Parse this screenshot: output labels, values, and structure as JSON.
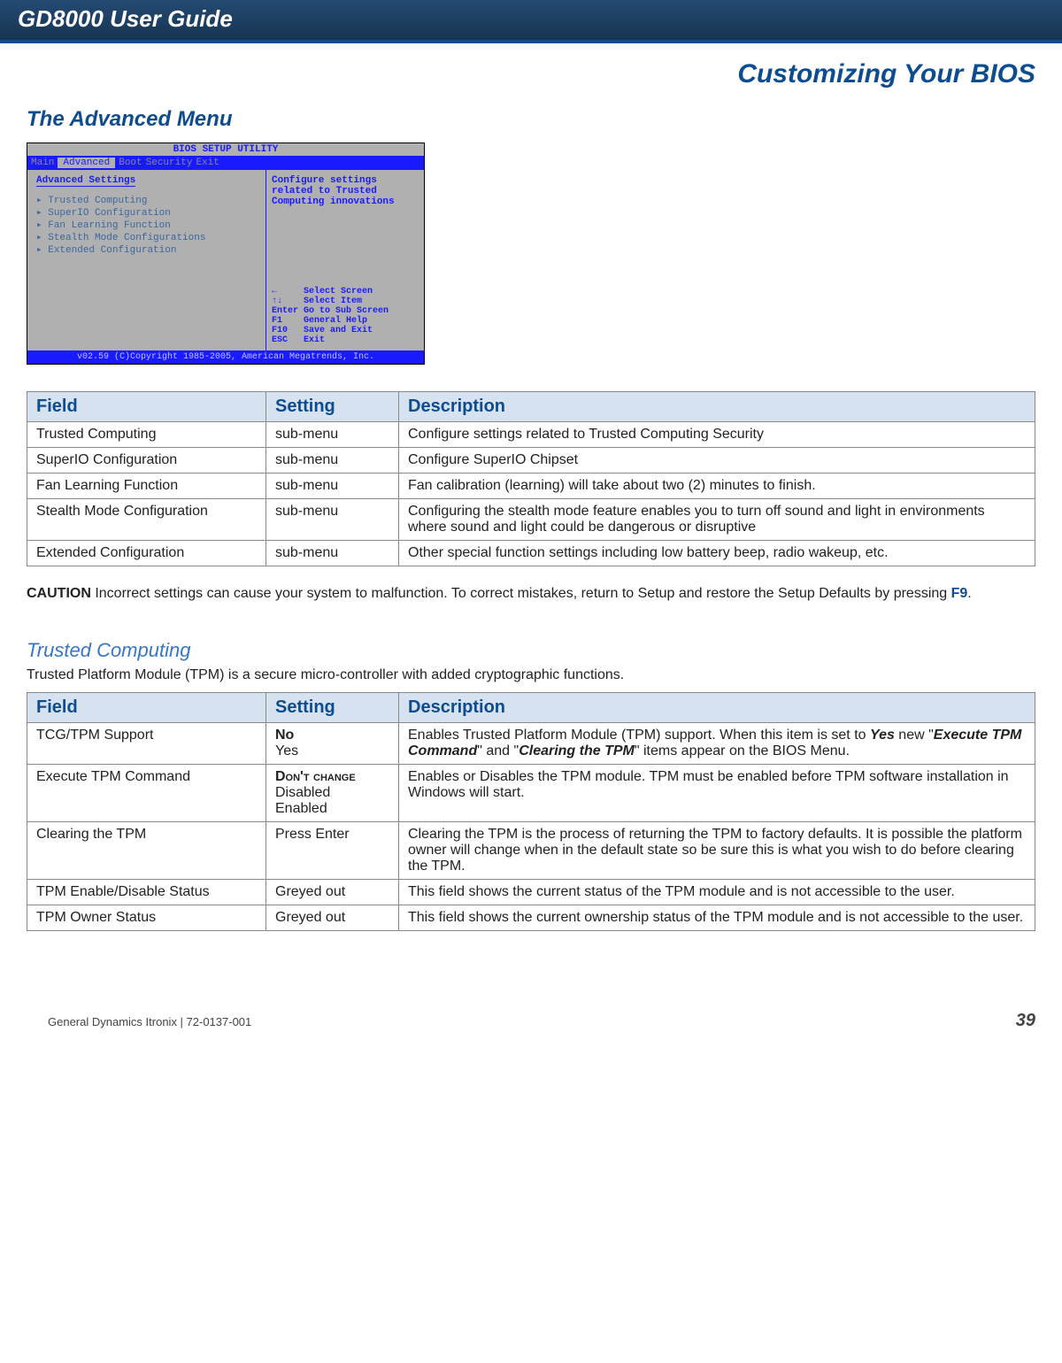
{
  "header": {
    "title": "GD8000 User Guide",
    "section": "Customizing Your BIOS"
  },
  "h2": "The Advanced Menu",
  "bios": {
    "top": "BIOS SETUP UTILITY",
    "tabs": [
      "Main",
      "Advanced",
      "Boot",
      "Security",
      "Exit"
    ],
    "group_title": "Advanced Settings",
    "items": [
      "Trusted Computing",
      "SuperIO Configuration",
      "Fan Learning Function",
      "Stealth Mode Configurations",
      "Extended Configuration"
    ],
    "right_desc": "Configure settings related to Trusted Computing innovations",
    "keys": "←     Select Screen\n↑↓    Select Item\nEnter Go to Sub Screen\nF1    General Help\nF10   Save and Exit\nESC   Exit",
    "foot": "v02.59 (C)Copyright 1985-2005, American Megatrends, Inc."
  },
  "table1": {
    "headers": [
      "Field",
      "Setting",
      "Description"
    ],
    "rows": [
      {
        "f": "Trusted Computing",
        "s": "sub-menu",
        "d": "Configure settings related to Trusted Computing Security"
      },
      {
        "f": "SuperIO Configuration",
        "s": "sub-menu",
        "d": "Configure SuperIO Chipset"
      },
      {
        "f": "Fan Learning Function",
        "s": "sub-menu",
        "d": "Fan calibration (learning) will take about two (2) minutes to finish."
      },
      {
        "f": "Stealth Mode Configuration",
        "s": "sub-menu",
        "d": "Configuring the stealth mode feature enables you to turn off  sound and light in environments where sound and light could be dangerous or disruptive"
      },
      {
        "f": "Extended Configuration",
        "s": "sub-menu",
        "d": "Other special function settings including low battery beep, radio wakeup, etc."
      }
    ]
  },
  "caution": {
    "word": "CAUTION",
    "text1": "  Incorrect settings can cause your system to malfunction.  To correct mistakes, return to Setup and restore the Setup Defaults by pressing ",
    "key": "F9",
    "text2": "."
  },
  "tc": {
    "head": "Trusted Computing",
    "intro": "Trusted Platform Module (TPM) is a secure micro-controller with added cryptographic functions."
  },
  "table2": {
    "headers": [
      "Field",
      "Setting",
      "Description"
    ],
    "rows": [
      {
        "f": "TCG/TPM Support",
        "s_bold": "No",
        "s_rest": "Yes",
        "d_pre": "Enables Trusted Platform Module (TPM) support. When this item is set to ",
        "d_e1": "Yes",
        "d_mid1": " new \"",
        "d_e2": "Execute TPM Command",
        "d_mid2": "\" and  \"",
        "d_e3": "Clearing the TPM",
        "d_post": "\" items appear on the BIOS Menu."
      },
      {
        "f": "Execute TPM Command",
        "s_sc": "Don't change",
        "s_rest": "Disabled\nEnabled",
        "d": "Enables or Disables the TPM module. TPM must be enabled before TPM software installation in Windows will start."
      },
      {
        "f": "Clearing the TPM",
        "s": "Press Enter",
        "d": "Clearing the TPM is the process of returning the TPM to factory defaults. It is possible the platform owner will change when in the default state so be sure this is what you wish to do before clearing the TPM."
      },
      {
        "f": "TPM Enable/Disable Status",
        "s": "Greyed out",
        "d": "This field shows the current status of the TPM module and is not accessible to the user."
      },
      {
        "f": "TPM Owner Status",
        "s": "Greyed out",
        "d": "This field shows the current ownership status of the TPM module and is not accessible to the user."
      }
    ]
  },
  "footer": {
    "left": "General Dynamics Itronix | 72-0137-001",
    "page": "39"
  }
}
